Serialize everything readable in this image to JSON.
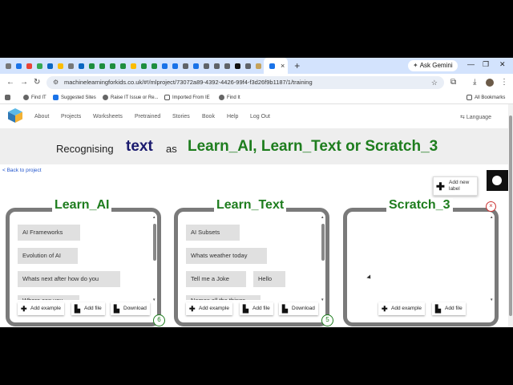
{
  "browser": {
    "new_tab_symbol": "+",
    "close_symbol": "×",
    "ask_gemini": "Ask Gemini",
    "url": "machinelearningforkids.co.uk/#!/mlproject/73072a89-4392-4426-99f4-f3d26f9b1187/1/training",
    "bookmarks": [
      "Find IT",
      "Suggested Sites",
      "Raise IT Issue or Re...",
      "Imported From IE",
      "Find It"
    ],
    "all_bookmarks": "All Bookmarks",
    "tab_favicon_colors": [
      "#777777",
      "#1a73e8",
      "#ea4335",
      "#34a853",
      "#0a66c2",
      "#fbbc04",
      "#777777",
      "#0a66c2",
      "#1e8e3e",
      "#1e8e3e",
      "#1e8e3e",
      "#1e8e3e",
      "#fbbc04",
      "#1e8e3e",
      "#1e8e3e",
      "#1a73e8",
      "#1a73e8",
      "#5f6368",
      "#1a73e8",
      "#5f6368",
      "#5f6368",
      "#5f6368",
      "#111111",
      "#5f6368",
      "#c5a25b",
      "#1a73e8"
    ]
  },
  "site": {
    "nav": [
      "About",
      "Projects",
      "Worksheets",
      "Pretrained",
      "Stories",
      "Book",
      "Help",
      "Log Out"
    ],
    "language": "Language",
    "banner": {
      "recognising": "Recognising",
      "type": "text",
      "as": "as",
      "labels": "Learn_AI, Learn_Text or Scratch_3"
    },
    "back_link": "< Back to project",
    "add_new_label": "Add new label"
  },
  "label_buckets": [
    {
      "name": "Learn_AI",
      "examples": [
        "AI Frameworks",
        "Evolution of AI",
        "Whats next after how do you",
        "Where can you"
      ],
      "count": "6",
      "buttons": [
        "Add example",
        "Add file",
        "Download"
      ]
    },
    {
      "name": "Learn_Text",
      "examples": [
        "AI Subsets",
        "Whats weather today",
        "Tell me a Joke",
        "Hello",
        "Names all the things"
      ],
      "count": "5",
      "buttons": [
        "Add example",
        "Add file",
        "Download"
      ]
    },
    {
      "name": "Scratch_3",
      "examples": [],
      "buttons": [
        "Add example",
        "Add file"
      ]
    }
  ],
  "colors": {
    "label_green": "#1e7d1e",
    "type_navy": "#1a1a6e",
    "box_border": "#7a7a7a",
    "tab_strip": "#d3e3fd"
  }
}
